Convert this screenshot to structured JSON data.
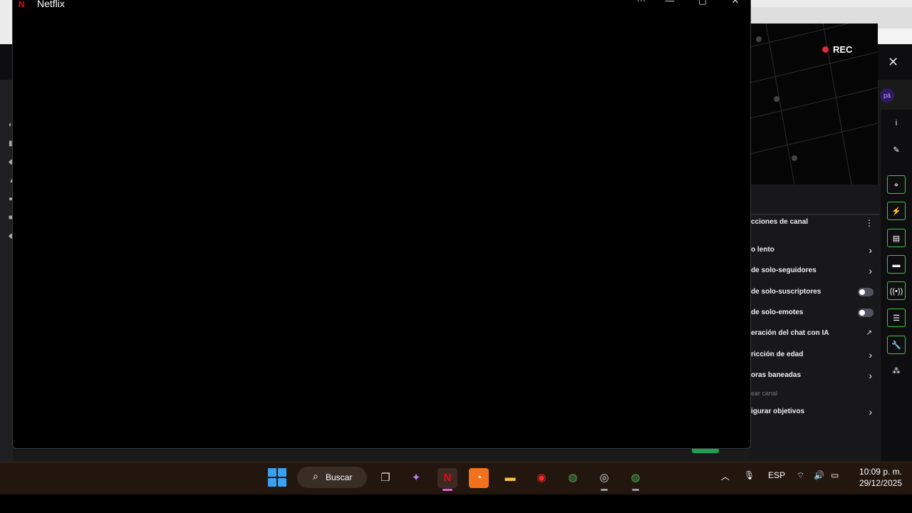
{
  "netflix_window": {
    "title": "Netflix",
    "logo": "N",
    "min": "—",
    "max": "▢",
    "close": "✕"
  },
  "preview": {
    "rec_label": "REC",
    "close": "✕",
    "avatar_text": "pá"
  },
  "chat_settings": {
    "header": "cciones de canal",
    "menu": "⋮",
    "items": [
      {
        "label": "o lento",
        "control": "chevron"
      },
      {
        "label": "de solo-seguidores",
        "control": "chevron"
      },
      {
        "label": "de solo-suscriptores",
        "control": "toggle",
        "on": false
      },
      {
        "label": "de solo-emotes",
        "control": "toggle",
        "on": false
      },
      {
        "label": "eración del chat con IA",
        "control": "external"
      },
      {
        "label": "ricción de edad",
        "control": "chevron"
      },
      {
        "label": "oras baneadas",
        "control": "chevron"
      },
      {
        "label": "ear canal",
        "control": "none"
      },
      {
        "label": "igurar objetivos",
        "control": "chevron"
      }
    ],
    "chevron": "›",
    "external": "↗"
  },
  "right_toolbar": {
    "icons": [
      "info-icon",
      "pencil-icon",
      "focus-icon",
      "lightning-icon",
      "document-icon",
      "chat-bubble-icon",
      "broadcast-icon",
      "layout-icon",
      "wrench-icon",
      "extensions-icon"
    ],
    "glyphs": [
      "i",
      "✎",
      "⌖",
      "⚡",
      "▤",
      "▬",
      "((•))",
      "☰",
      "🔧",
      "⁂"
    ]
  },
  "taskbar": {
    "search_label": "Buscar",
    "language": "ESP",
    "time": "10:09 p. m.",
    "date": "29/12/2025",
    "accent": "#3aa0f0"
  }
}
